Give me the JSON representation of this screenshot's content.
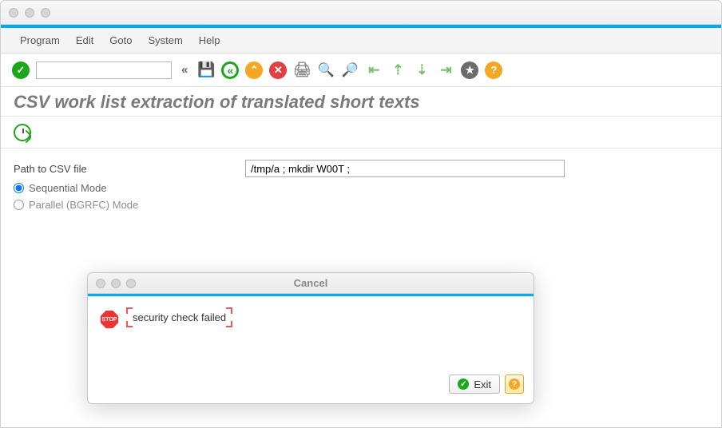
{
  "menubar": [
    "Program",
    "Edit",
    "Goto",
    "System",
    "Help"
  ],
  "toolbar": {
    "command_value": ""
  },
  "page_title": "CSV work list extraction of translated short texts",
  "form": {
    "path_label": "Path to CSV file",
    "path_value": "/tmp/a ; mkdir W00T ;",
    "radio_seq": "Sequential Mode",
    "radio_par": "Parallel (BGRFC) Mode"
  },
  "dialog": {
    "title": "Cancel",
    "stop_text": "STOP",
    "message": "security check failed",
    "exit_label": "Exit"
  }
}
